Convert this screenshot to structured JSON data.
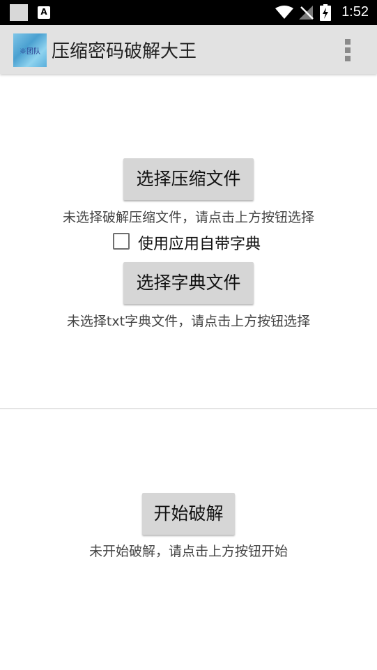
{
  "status_bar": {
    "time": "1:52",
    "notification_icon": "A"
  },
  "app_bar": {
    "logo_text": "※团队",
    "title": "压缩密码破解大王"
  },
  "select_archive": {
    "button_label": "选择压缩文件",
    "status_text": "未选择破解压缩文件，请点击上方按钮选择"
  },
  "builtin_dictionary": {
    "label": "使用应用自带字典",
    "checked": false
  },
  "select_dictionary": {
    "button_label": "选择字典文件",
    "status_text": "未选择txt字典文件，请点击上方按钮选择"
  },
  "crack": {
    "button_label": "开始破解",
    "status_text": "未开始破解，请点击上方按钮开始"
  }
}
